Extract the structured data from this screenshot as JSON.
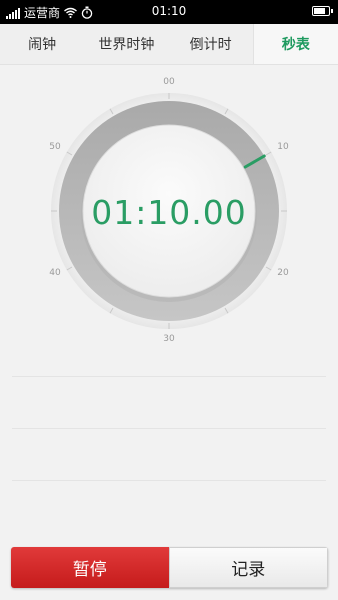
{
  "status_bar": {
    "carrier": "运营商",
    "time": "01:10",
    "icons": [
      "signal-icon",
      "wifi-icon",
      "stopwatch-status-icon",
      "battery-icon"
    ]
  },
  "tabs": [
    {
      "label": "闹钟",
      "active": false
    },
    {
      "label": "世界时钟",
      "active": false
    },
    {
      "label": "倒计时",
      "active": false
    },
    {
      "label": "秒表",
      "active": true
    }
  ],
  "stopwatch": {
    "elapsed": "01:10.00",
    "dial_labels": [
      "00",
      "10",
      "20",
      "30",
      "40",
      "50"
    ],
    "progress_seconds": 10,
    "accent_color": "#2a9d64"
  },
  "buttons": {
    "pause": "暂停",
    "lap": "记录"
  },
  "colors": {
    "accent": "#1e9a5f",
    "pause_button": "#d62a2a"
  }
}
